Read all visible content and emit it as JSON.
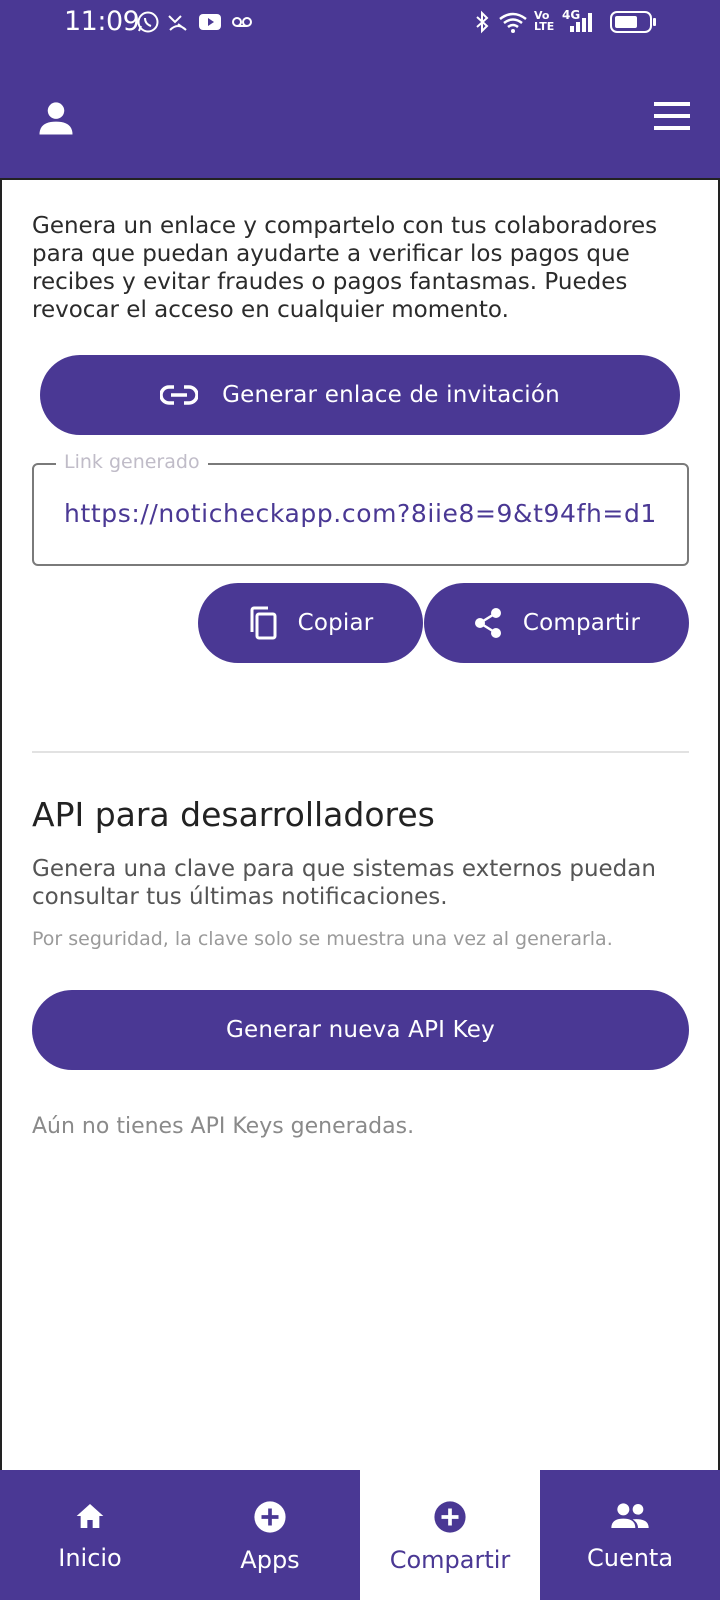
{
  "status_bar": {
    "time": "11:09",
    "left_icons": [
      "whatsapp-icon",
      "missed-call-icon",
      "youtube-icon",
      "voicemail-icon"
    ],
    "right_icons": [
      "bluetooth-icon",
      "wifi-icon",
      "volte-icon",
      "signal-4g-icon",
      "battery-icon"
    ],
    "network_label": "4G",
    "volte_label": "Vo LTE"
  },
  "app_bar": {
    "profile_icon": "person-icon",
    "menu_icon": "hamburger-menu-icon"
  },
  "invite": {
    "description": "Genera un enlace y compartelo con tus colaboradores para que puedan ayudarte a verificar los pagos que recibes y evitar fraudes o pagos fantasmas. Puedes revocar el acceso en cualquier momento.",
    "generate_label": "Generar enlace de invitación",
    "link_label": "Link generado",
    "link_value": "https://noticheckapp.com?8iie8=9&t94fh=d1",
    "copy_label": "Copiar",
    "share_label": "Compartir"
  },
  "api": {
    "title": "API para desarrolladores",
    "description": "Genera una clave para que sistemas externos puedan consultar tus últimas notificaciones.",
    "note": "Por seguridad, la clave solo se muestra una vez al generarla.",
    "generate_label": "Generar nueva API Key",
    "empty_text": "Aún no tienes API Keys generadas."
  },
  "bottom_nav": {
    "items": [
      {
        "label": "Inicio",
        "icon": "home-icon"
      },
      {
        "label": "Apps",
        "icon": "add-circle-icon"
      },
      {
        "label": "Compartir",
        "icon": "add-circle-icon",
        "active": true
      },
      {
        "label": "Cuenta",
        "icon": "group-icon"
      }
    ]
  },
  "colors": {
    "primary": "#4a3894",
    "background": "#ffffff",
    "muted_text": "#9a9a9a"
  }
}
